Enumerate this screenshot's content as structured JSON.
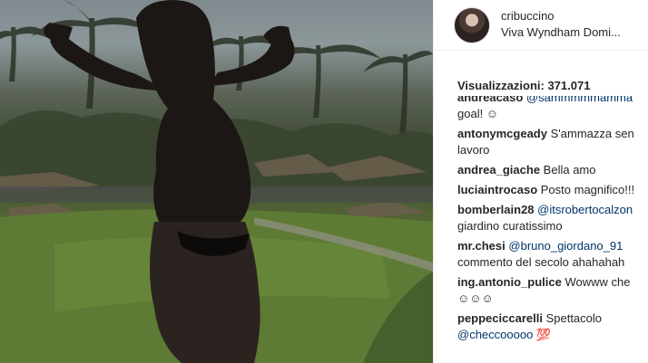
{
  "post": {
    "username": "cribuccino",
    "location": "Viva Wyndham Domi...",
    "views": "Visualizzazioni: 371.071"
  },
  "comments": [
    {
      "author": "andreacaso",
      "mention": "@sammmmmamma",
      "text": "goal! ☺"
    },
    {
      "author": "antonymcgeady",
      "text": "S'ammazza sen",
      "text2": "lavoro"
    },
    {
      "author": "andrea_giache",
      "text": "Bella amo"
    },
    {
      "author": "luciaintrocaso",
      "text": "Posto magnifico!!!"
    },
    {
      "author": "bomberlain28",
      "mention": "@itsrobertocalzon",
      "text2": "giardino curatissimo"
    },
    {
      "author": "mr.chesi",
      "mention": "@bruno_giordano_91",
      "text2": "commento del secolo ahahahah"
    },
    {
      "author": "ing.antonio_pulice",
      "text": "Wowww che",
      "text2": "☺☺☺"
    },
    {
      "author": "peppeciccarelli",
      "text": "Spettacolo",
      "mention": "@checcooooo 💯"
    }
  ],
  "icons": {
    "avatar": "profile-avatar"
  }
}
